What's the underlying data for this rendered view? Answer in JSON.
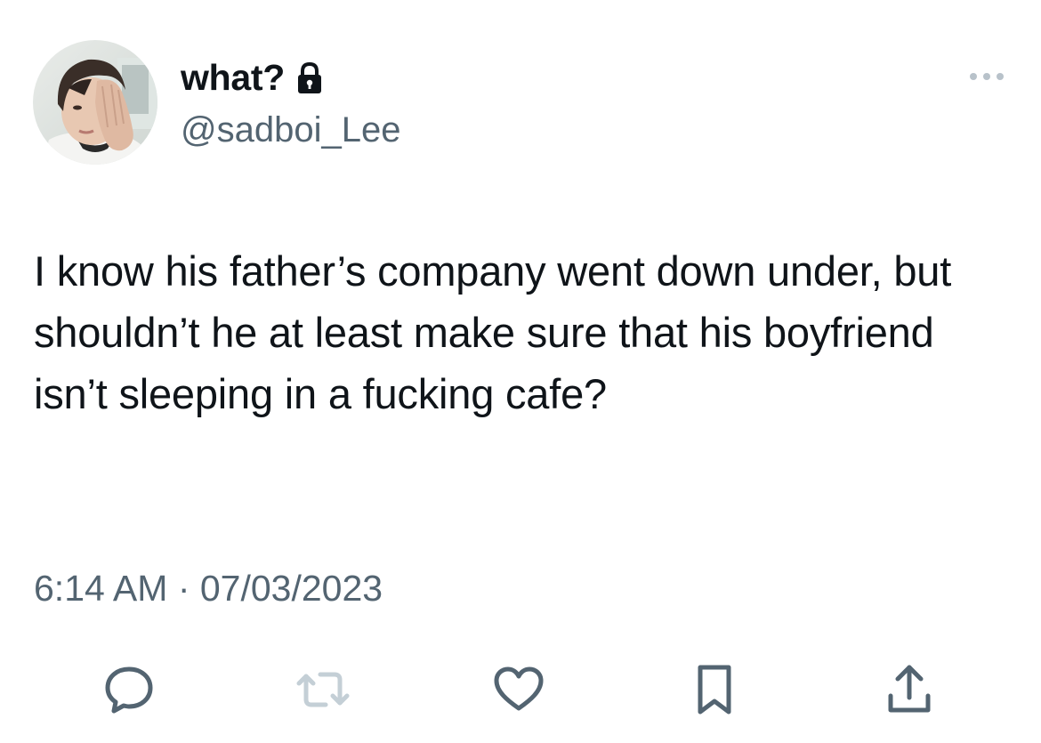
{
  "user": {
    "display_name": "what?",
    "handle": "@sadboi_Lee",
    "verified_icon": "lock-icon",
    "avatar_icon": "avatar"
  },
  "tweet": {
    "text": "I know his father’s company went down under, but shouldn’t he at least make sure that his boyfriend isn’t sleeping in a fucking cafe?",
    "timestamp": "6:14 AM · 07/03/2023"
  },
  "actions": [
    {
      "name": "reply",
      "icon": "speech-bubble-icon"
    },
    {
      "name": "retweet",
      "icon": "retweet-icon",
      "disabled": true
    },
    {
      "name": "like",
      "icon": "heart-icon"
    },
    {
      "name": "bookmark",
      "icon": "bookmark-icon"
    },
    {
      "name": "share",
      "icon": "share-icon"
    }
  ],
  "colors": {
    "text_primary": "#0f1419",
    "text_secondary": "#536471",
    "icon": "#536471",
    "icon_disabled": "#c4cfd6",
    "background": "#ffffff"
  }
}
